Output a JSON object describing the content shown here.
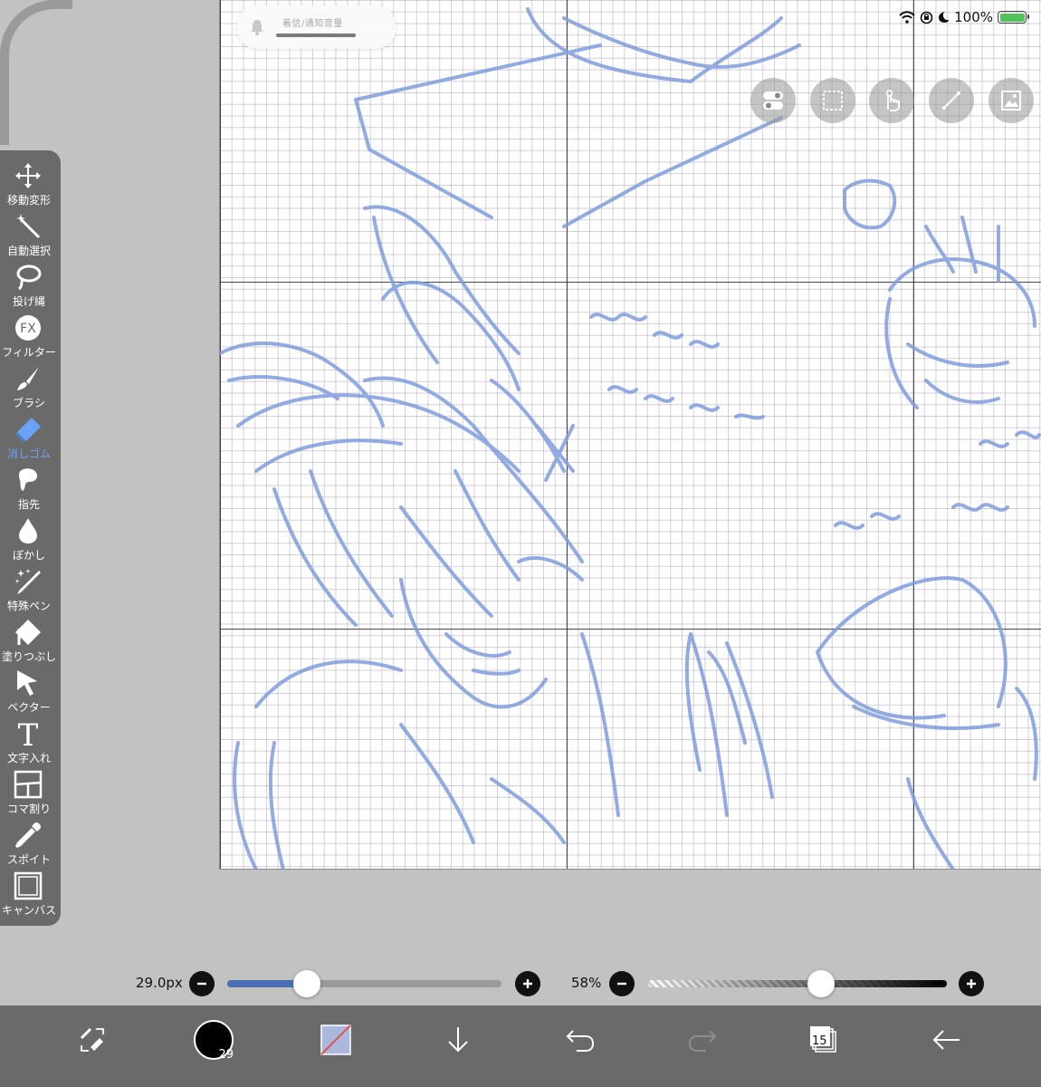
{
  "notification": {
    "text": "着信/通知音量"
  },
  "status_bar": {
    "battery": "100%"
  },
  "top_tools": [
    {
      "icon": "toggle-icon"
    },
    {
      "icon": "selection-icon"
    },
    {
      "icon": "hand-touch-icon"
    },
    {
      "icon": "ruler-icon"
    },
    {
      "icon": "image-layer-icon"
    }
  ],
  "toolbar": {
    "items": [
      {
        "label": "移動変形",
        "icon": "move-icon",
        "active": false
      },
      {
        "label": "自動選択",
        "icon": "magic-wand-icon",
        "active": false
      },
      {
        "label": "投げ縄",
        "icon": "lasso-icon",
        "active": false
      },
      {
        "label": "フィルター",
        "icon": "filter-fx-icon",
        "active": false
      },
      {
        "label": "ブラシ",
        "icon": "brush-icon",
        "active": false
      },
      {
        "label": "消しゴム",
        "icon": "eraser-icon",
        "active": true
      },
      {
        "label": "指先",
        "icon": "finger-smudge-icon",
        "active": false
      },
      {
        "label": "ぼかし",
        "icon": "blur-drop-icon",
        "active": false
      },
      {
        "label": "特殊ペン",
        "icon": "special-pen-icon",
        "active": false
      },
      {
        "label": "塗りつぶし",
        "icon": "fill-bucket-icon",
        "active": false
      },
      {
        "label": "ベクター",
        "icon": "vector-cursor-icon",
        "active": false
      },
      {
        "label": "文字入れ",
        "icon": "text-icon",
        "active": false
      },
      {
        "label": "コマ割り",
        "icon": "panel-divide-icon",
        "active": false
      },
      {
        "label": "スポイト",
        "icon": "eyedropper-icon",
        "active": false
      },
      {
        "label": "キャンバス",
        "icon": "canvas-icon",
        "active": false
      }
    ]
  },
  "brush_size": {
    "value": "29.0px",
    "fraction": 0.29
  },
  "opacity": {
    "value": "58%",
    "fraction": 0.58
  },
  "bottom_bar": {
    "brush_preview_number": "29",
    "layer_count": "15"
  },
  "colors": {
    "toolbar_bg": "#6a6a6a",
    "active_tool": "#6aa2f5",
    "sketch": "#7f9ddd",
    "slider_blue": "#4a6fb5"
  }
}
